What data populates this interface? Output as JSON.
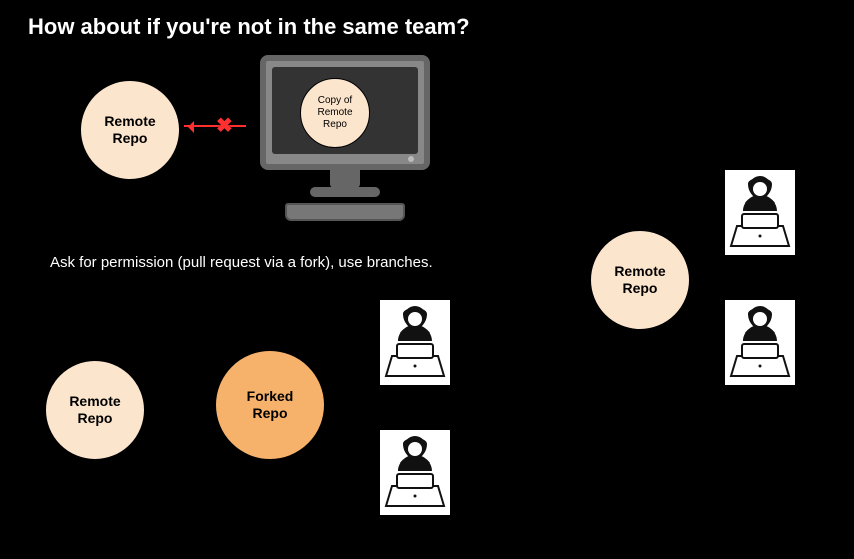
{
  "heading": "How about if you're not in the same team?",
  "paragraph": "Ask for permission (pull request via a fork), use branches.",
  "nodes": {
    "remoteTopLeft": "Remote\nRepo",
    "copyRemote": "Copy of\nRemote\nRepo",
    "remoteBottomLeft": "Remote\nRepo",
    "forkedRepo": "Forked\nRepo",
    "remoteRight": "Remote\nRepo"
  },
  "alts": {
    "computer": "Desktop computer",
    "user": "Person with laptop",
    "blockedArrow": "Blocked push arrow"
  },
  "colors": {
    "lightCircle": "#fce5cd",
    "darkCircle": "#f6b26b",
    "arrow": "#ff3030"
  }
}
